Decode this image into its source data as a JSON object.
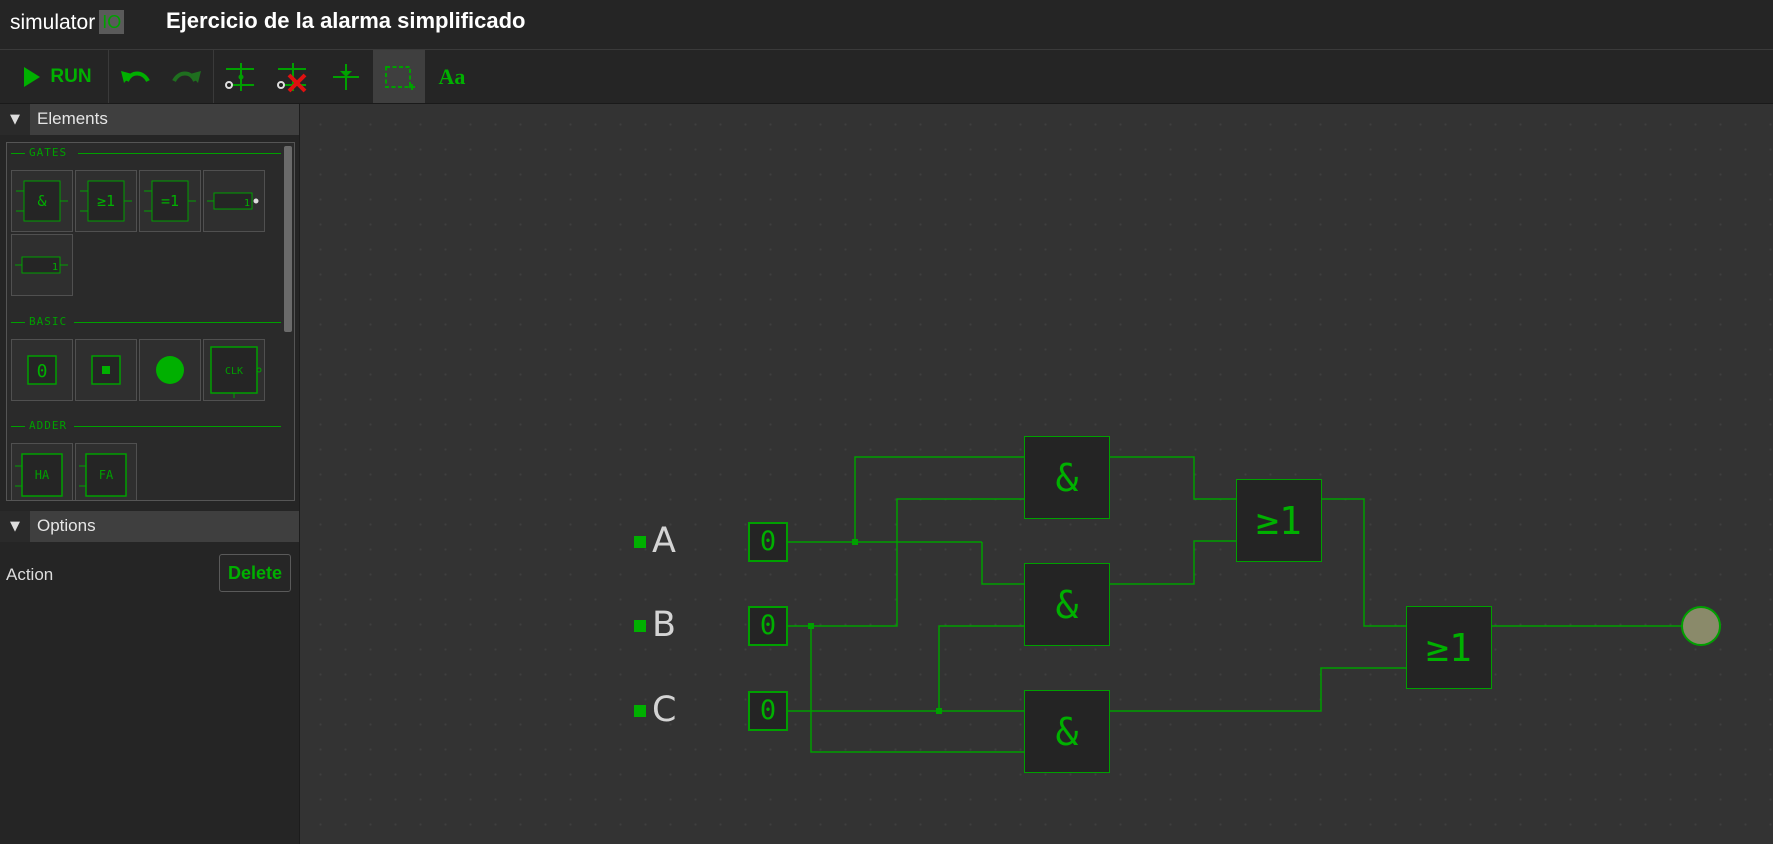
{
  "app": {
    "brand_name": "simulator",
    "brand_badge": "IO",
    "project_title": "Ejercicio de la alarma simplificado"
  },
  "toolbar": {
    "run_label": "RUN",
    "font_label": "Aa",
    "tools": [
      "run",
      "undo",
      "redo",
      "add-wire-connection",
      "delete-wire-connection",
      "wire-junction",
      "select-area",
      "text"
    ],
    "active_tool": "select-area"
  },
  "sidebar": {
    "elements_title": "Elements",
    "sections": {
      "gates": "GATES",
      "basic": "BASIC",
      "adder": "ADDER"
    },
    "gate_tiles": [
      "&",
      "≥1",
      "=1",
      "1",
      "1"
    ],
    "basic_tiles": [
      "0",
      "",
      "",
      "CLK"
    ],
    "adder_tiles": [
      "HA",
      "FA"
    ],
    "options_title": "Options",
    "action_label": "Action",
    "delete_label": "Delete"
  },
  "circuit": {
    "inputs": [
      {
        "label": "A",
        "value": "0"
      },
      {
        "label": "B",
        "value": "0"
      },
      {
        "label": "C",
        "value": "0"
      }
    ],
    "and_gates": [
      "&",
      "&",
      "&"
    ],
    "or_gates": [
      "≥1",
      "≥1"
    ],
    "output_state": "off"
  },
  "colors": {
    "accent": "#00a000",
    "background": "#333333",
    "panel": "#252525",
    "lamp_off": "#8a8a6a"
  }
}
